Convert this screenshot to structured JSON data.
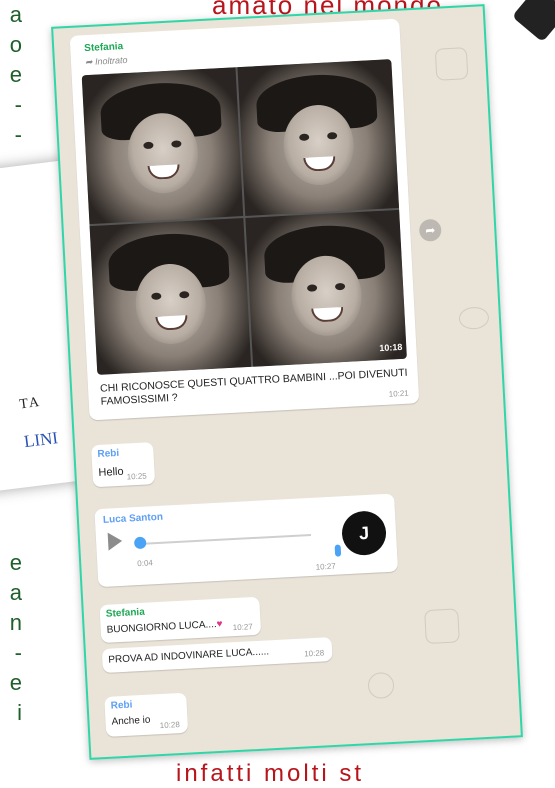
{
  "background": {
    "top_text": "amato nel mondo,",
    "bottom_text": "infatti molti st",
    "left_top_fragments": [
      "a",
      "o",
      "e",
      "-",
      "-"
    ],
    "left_bottom_fragments": [
      "e",
      "a",
      "n",
      "-",
      "e",
      "i"
    ]
  },
  "paper": {
    "text_1": "TA",
    "text_2": "LINI"
  },
  "chat": {
    "messages": [
      {
        "sender": "Stefania",
        "forwarded": "Inoltrato",
        "photo_time": "10:18",
        "caption": "CHI RICONOSCE QUESTI QUATTRO BAMBINI ...POI DIVENUTI FAMOSISSIMI ?",
        "time": "10:21"
      },
      {
        "sender": "Rebi",
        "text": "Hello",
        "time": "10:25"
      },
      {
        "sender": "Luca Santon",
        "duration": "0:04",
        "time": "10:27",
        "avatar": "J"
      },
      {
        "sender": "Stefania",
        "text": "BUONGIORNO LUCA....",
        "time": "10:27"
      },
      {
        "text": "PROVA AD INDOVINARE LUCA......",
        "time": "10:28"
      },
      {
        "sender": "Rebi",
        "text": "Anche io",
        "time": "10:28"
      }
    ]
  },
  "colors": {
    "chat_bg": "#e9e3d8",
    "frame_border": "#2fd7a8",
    "sender_green": "#1fa855",
    "sender_blue": "#5d9ff5",
    "article_red": "#b8141c",
    "article_green": "#1f5f2a"
  },
  "icons": {
    "forward": "forward-arrow-icon",
    "share": "share-icon",
    "play": "play-icon",
    "mic": "microphone-icon"
  }
}
